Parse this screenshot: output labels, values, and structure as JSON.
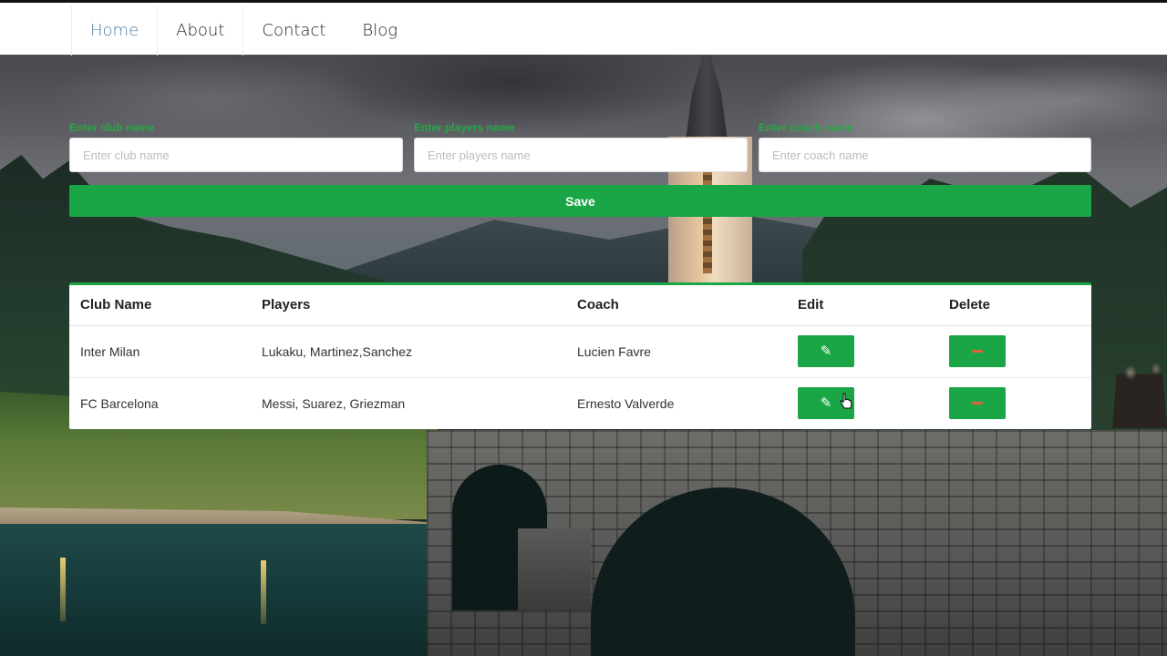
{
  "nav": {
    "items": [
      {
        "label": "Home",
        "active": true
      },
      {
        "label": "About",
        "active": false
      },
      {
        "label": "Contact",
        "active": false
      },
      {
        "label": "Blog",
        "active": false
      }
    ]
  },
  "form": {
    "club": {
      "label": "Enter club name",
      "placeholder": "Enter club name",
      "value": ""
    },
    "players": {
      "label": "Enter players name",
      "placeholder": "Enter players name",
      "value": ""
    },
    "coach": {
      "label": "Enter coach name",
      "placeholder": "Enter coach name",
      "value": ""
    },
    "save_label": "Save"
  },
  "table": {
    "headers": {
      "club": "Club Name",
      "players": "Players",
      "coach": "Coach",
      "edit": "Edit",
      "delete": "Delete"
    },
    "rows": [
      {
        "club": "Inter Milan",
        "players": "Lukaku, Martinez,Sanchez",
        "coach": "Lucien Favre"
      },
      {
        "club": "FC Barcelona",
        "players": "Messi, Suarez, Griezman",
        "coach": "Ernesto Valverde"
      }
    ]
  },
  "icons": {
    "edit": "edit-icon",
    "delete": "minus-icon"
  },
  "colors": {
    "accent": "#1aa546",
    "label_green": "#28a745",
    "nav_active": "#4f7fa0",
    "delete_glyph": "#e0633a"
  }
}
